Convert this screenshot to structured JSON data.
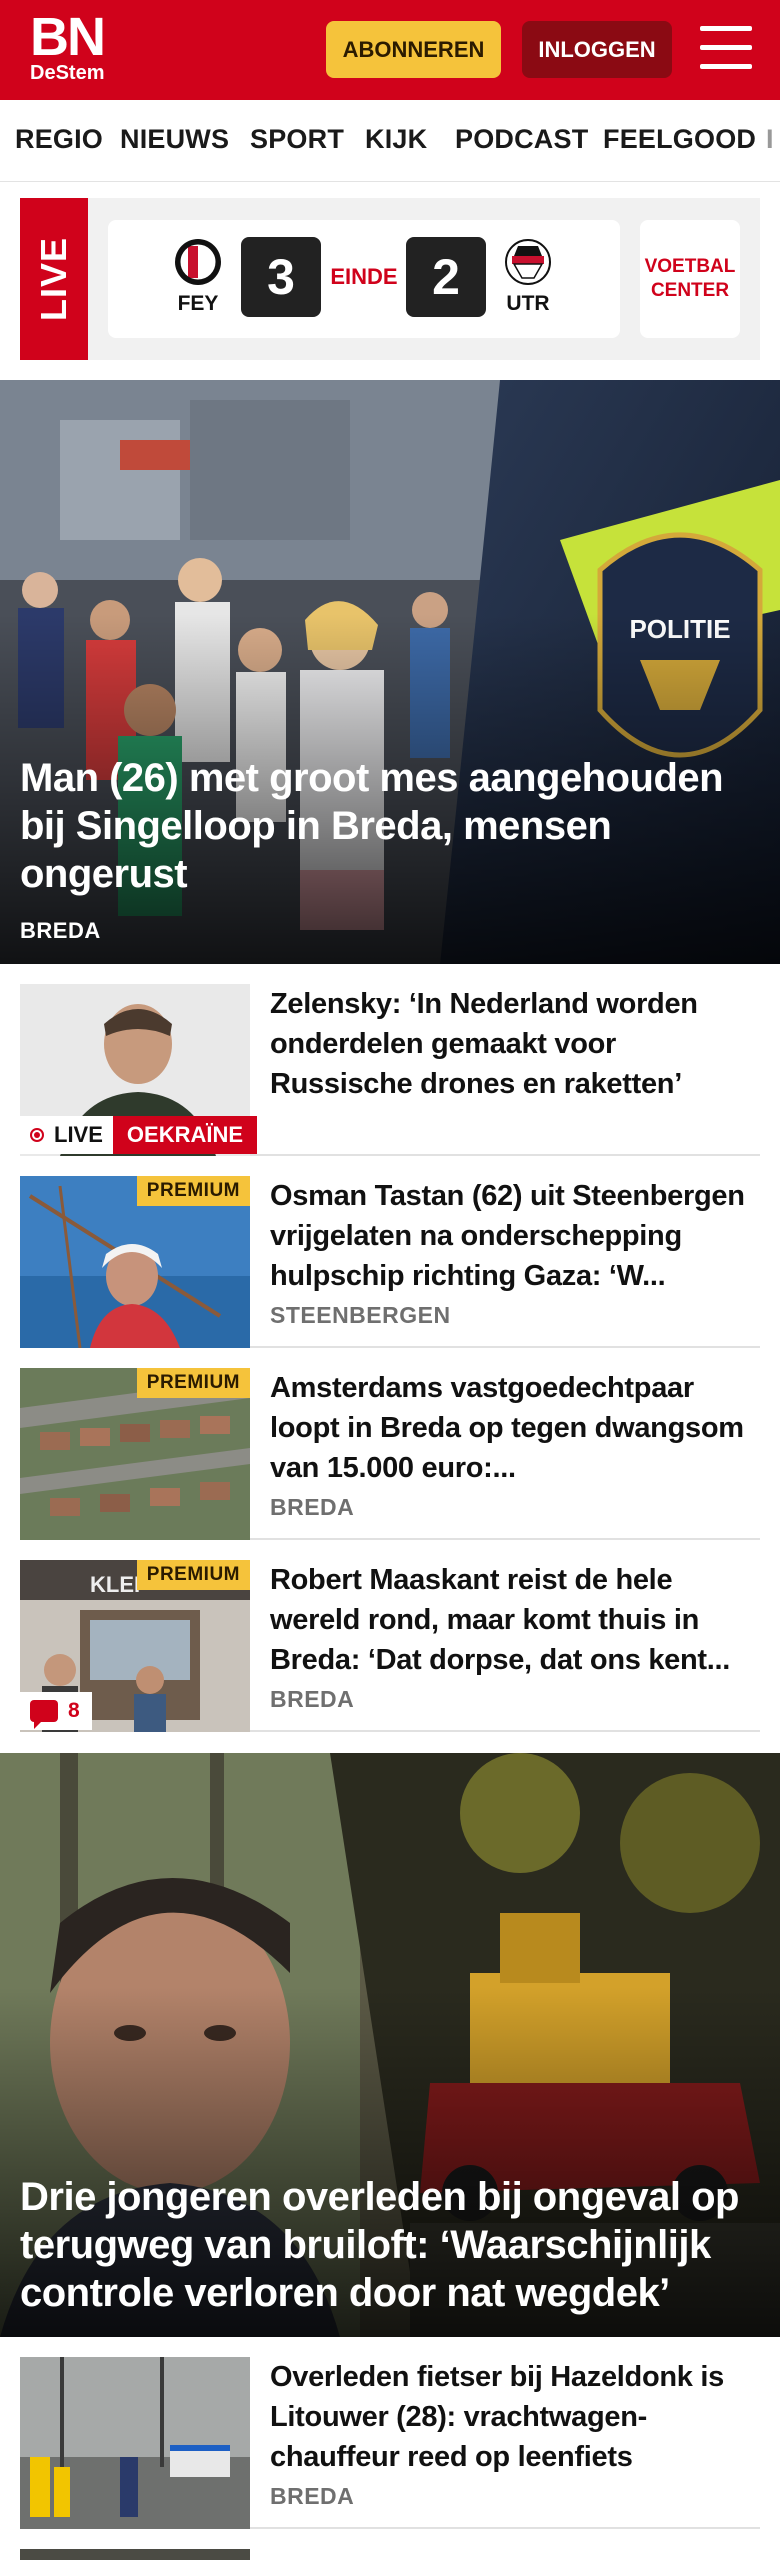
{
  "header": {
    "logo_main": "BN",
    "logo_sub": "DeStem",
    "subscribe_label": "ABONNEREN",
    "login_label": "INLOGGEN",
    "brand_color": "#d0021b"
  },
  "nav": {
    "items": [
      "REGIO",
      "NIEUWS",
      "SPORT",
      "KIJK",
      "PODCAST",
      "FEELGOOD",
      "I"
    ]
  },
  "live": {
    "badge": "LIVE",
    "home_team": "FEY",
    "home_score": "3",
    "status": "EINDE",
    "away_score": "2",
    "away_team": "UTR",
    "center_label_1": "VOETBAL",
    "center_label_2": "CENTER"
  },
  "hero1": {
    "title": "Man (26) met groot mes aangehouden bij Singelloop in Breda, mensen ongerust",
    "tag": "BREDA"
  },
  "articles": [
    {
      "title": "Zelensky: ‘In Nederland worden onderdelen gemaakt voor Russische drones en raketten’",
      "live_label": "LIVE",
      "topic": "OEKRAÏNE"
    },
    {
      "title": "Osman Tastan (62) uit Steenber­gen vrijgelaten na onderschep­ping hulpschip richting Gaza: ‘W...",
      "tag": "STEENBERGEN",
      "badge": "PREMIUM"
    },
    {
      "title": "Amsterdams vastgoedechtpaar loopt in Breda op tegen dwangsom van 15.000 euro:...",
      "tag": "BREDA",
      "badge": "PREMIUM"
    },
    {
      "title": "Robert Maaskant reist de hele wereld rond, maar komt thuis in Breda: ‘Dat dorpse, dat ons kent...",
      "tag": "BREDA",
      "badge": "PREMIUM",
      "comments": "8"
    }
  ],
  "hero2": {
    "title": "Drie jongeren overleden bij ongeval op terugweg van bruiloft: ‘Waarschijnlijk controle verloren door nat wegdek’"
  },
  "articles2": [
    {
      "title": "Overleden fietser bij Hazeldonk is Litouwer (28): vrachtwagen­chauffeur reed op leenfiets",
      "tag": "BREDA"
    }
  ]
}
